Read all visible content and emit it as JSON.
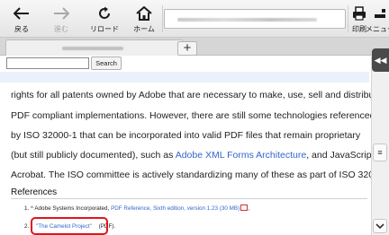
{
  "toolbar": {
    "back_label": "戻る",
    "forward_label": "進む",
    "reload_label": "リロード",
    "home_label": "ホーム",
    "print_label": "印刷",
    "menu_label": "メニュー"
  },
  "tabs": {
    "new_tab_symbol": "+"
  },
  "search": {
    "value": "",
    "button_label": "Search"
  },
  "article": {
    "lines": [
      "rights for all patents owned by Adobe that are necessary to make, use, sell and distribute",
      "PDF compliant implementations. However, there are still some technologies referenced",
      "by ISO 32000-1 that can be incorporated into valid PDF files that remain proprietary"
    ],
    "line4_before": "(but still publicly documented), such as ",
    "line4_link": "Adobe XML Forms Architecture",
    "line4_after": ", and JavaScript for",
    "line5": "Acrobat. The ISO committee is actively standardizing many of these as part of ISO 32000-2."
  },
  "references": {
    "heading": "References",
    "item1_prefix": "1. ^ Adobe Systems Incorporated, ",
    "item1_link": "PDF Reference, Sixth edition, version 1.23 (30 MB)",
    "item1_suffix": ",",
    "item2_prefix": "2. ",
    "item2_link": "\"The Camelot Project\"",
    "item2_suffix": " (PDF)."
  },
  "side": {
    "collapse_symbol": "◀◀",
    "menu_symbol": "≡"
  },
  "colors": {
    "link": "#3366cc",
    "highlight": "#e0141e"
  }
}
